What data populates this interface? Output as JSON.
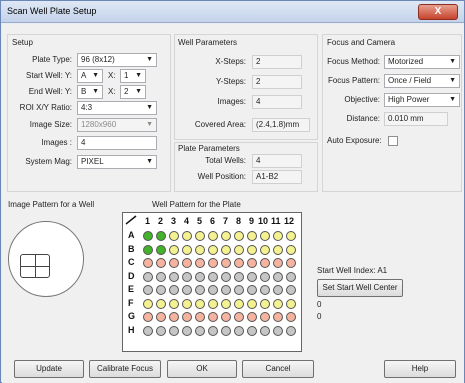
{
  "title": "Scan Well Plate Setup",
  "close_label": "X",
  "colors": {
    "green": "#43b32c",
    "yellow": "#f4f190",
    "orange": "#f6b3a0",
    "gray": "#c6c6c6"
  },
  "setup": {
    "header": "Setup",
    "plate_type_label": "Plate Type:",
    "plate_type": "96 (8x12)",
    "start_well_label": "Start Well: Y:",
    "start_y": "A",
    "x_label": "X:",
    "start_x": "1",
    "end_well_label": "End Well: Y:",
    "end_y": "B",
    "end_x": "2",
    "roi_label": "ROI X/Y Ratio:",
    "roi": "4:3",
    "image_size_label": "Image Size:",
    "image_size": "1280x960",
    "images_label": "Images :",
    "images": "4",
    "system_mag_label": "System Mag:",
    "system_mag": "PIXEL"
  },
  "well_params": {
    "header": "Well Parameters",
    "xsteps_label": "X-Steps:",
    "xsteps": "2",
    "ysteps_label": "Y-Steps:",
    "ysteps": "2",
    "images_label": "Images:",
    "images": "4",
    "covered_label": "Covered Area:",
    "covered": "(2.4,1.8)mm"
  },
  "plate_params": {
    "header": "Plate Parameters",
    "total_label": "Total Wells:",
    "total": "4",
    "position_label": "Well Position:",
    "position": "A1-B2"
  },
  "focus": {
    "header": "Focus and Camera",
    "method_label": "Focus Method:",
    "method": "Motorized",
    "pattern_label": "Focus Pattern:",
    "pattern": "Once / Field",
    "objective_label": "Objective:",
    "objective": "High Power",
    "distance_label": "Distance:",
    "distance": "0.010 mm",
    "auto_exposure_label": "Auto Exposure:"
  },
  "image_pattern_label": "Image Pattern for a Well",
  "well_pattern_label": "Well Pattern for the Plate",
  "plate_rows": [
    "A",
    "B",
    "C",
    "D",
    "E",
    "F",
    "G",
    "H"
  ],
  "plate_cols": [
    "1",
    "2",
    "3",
    "4",
    "5",
    "6",
    "7",
    "8",
    "9",
    "10",
    "11",
    "12"
  ],
  "well_rows": [
    [
      "green",
      "green",
      "yellow",
      "yellow",
      "yellow",
      "yellow",
      "yellow",
      "yellow",
      "yellow",
      "yellow",
      "yellow",
      "yellow"
    ],
    [
      "green",
      "green",
      "yellow",
      "yellow",
      "yellow",
      "yellow",
      "yellow",
      "yellow",
      "yellow",
      "yellow",
      "yellow",
      "yellow"
    ],
    [
      "orange",
      "orange",
      "orange",
      "orange",
      "orange",
      "orange",
      "orange",
      "orange",
      "orange",
      "orange",
      "orange",
      "orange"
    ],
    [
      "gray",
      "gray",
      "gray",
      "gray",
      "gray",
      "gray",
      "gray",
      "gray",
      "gray",
      "gray",
      "gray",
      "gray"
    ],
    [
      "gray",
      "gray",
      "gray",
      "gray",
      "gray",
      "gray",
      "gray",
      "gray",
      "gray",
      "gray",
      "gray",
      "gray"
    ],
    [
      "yellow",
      "yellow",
      "yellow",
      "yellow",
      "yellow",
      "yellow",
      "yellow",
      "yellow",
      "yellow",
      "yellow",
      "yellow",
      "yellow"
    ],
    [
      "orange",
      "orange",
      "orange",
      "orange",
      "orange",
      "orange",
      "orange",
      "orange",
      "orange",
      "orange",
      "orange",
      "orange"
    ],
    [
      "gray",
      "gray",
      "gray",
      "gray",
      "gray",
      "gray",
      "gray",
      "gray",
      "gray",
      "gray",
      "gray",
      "gray"
    ]
  ],
  "start_well_index": "Start Well Index: A1",
  "set_start_button": "Set Start Well Center",
  "zero1": "0",
  "zero2": "0",
  "buttons": {
    "update": "Update",
    "calibrate": "Calibrate Focus",
    "ok": "OK",
    "cancel": "Cancel",
    "help": "Help"
  }
}
